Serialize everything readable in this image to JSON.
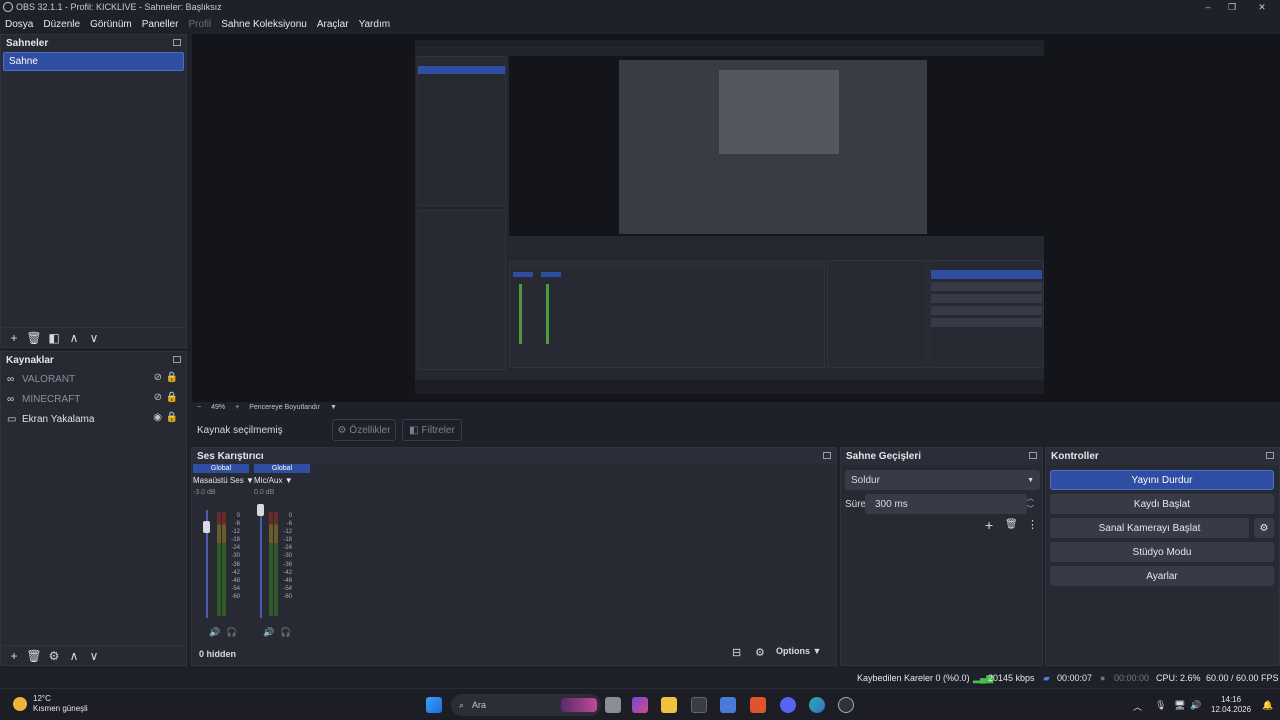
{
  "window": {
    "title": "OBS 32.1.1 - Profil: KICKLIVE - Sahneler: Başlıksız",
    "min": "–",
    "max": "❐",
    "close": "✕"
  },
  "menu": [
    "Dosya",
    "Düzenle",
    "Görünüm",
    "Paneller",
    "Profil",
    "Sahne Koleksiyonu",
    "Araçlar",
    "Yardım"
  ],
  "scenes": {
    "title": "Sahneler",
    "items": [
      "Sahne"
    ]
  },
  "sources": {
    "title": "Kaynaklar",
    "items": [
      {
        "name": "VALORANT",
        "icon": "gamepad-icon",
        "visible": false,
        "locked": true
      },
      {
        "name": "MINECRAFT",
        "icon": "gamepad-icon",
        "visible": false,
        "locked": true
      },
      {
        "name": "Ekran Yakalama",
        "icon": "monitor-icon",
        "visible": true,
        "locked": true
      }
    ]
  },
  "preview": {
    "zoom": "49%",
    "fit_label": "Pencereye Boyutlandır",
    "minus": "−",
    "plus": "+"
  },
  "context": {
    "no_source": "Kaynak seçilmemiş",
    "properties": "Özellikler",
    "filters": "Filtreler"
  },
  "mixer": {
    "title": "Ses Karıştırıcı",
    "channels": [
      {
        "scope": "Global",
        "name": "Masaüstü Ses",
        "db": "-3.0 dB"
      },
      {
        "scope": "Global",
        "name": "Mic/Aux",
        "db": "0.0 dB"
      }
    ],
    "scale": [
      "0",
      "-6",
      "-12",
      "-18",
      "-24",
      "-30",
      "-36",
      "-42",
      "-48",
      "-54",
      "-60"
    ],
    "hidden": "0 hidden",
    "options": "Options"
  },
  "transitions": {
    "title": "Sahne Geçişleri",
    "selected": "Soldur",
    "duration_label": "Süre",
    "duration": "300 ms"
  },
  "controls": {
    "title": "Kontroller",
    "stop_stream": "Yayını Durdur",
    "start_record": "Kaydı Başlat",
    "virtual_cam": "Sanal Kamerayı Başlat",
    "studio_mode": "Stüdyo Modu",
    "settings": "Ayarlar"
  },
  "status": {
    "dropped": "Kaybedilen Kareler 0 (%0.0)",
    "bitrate": "20145 kbps",
    "stream_time": "00:00:07",
    "rec_time": "00:00:00",
    "cpu": "CPU: 2.6%",
    "fps": "60.00 / 60.00 FPS"
  },
  "taskbar": {
    "temp": "12°C",
    "weather": "Kısmen güneşli",
    "search": "Ara",
    "time": "14:16",
    "date": "12.04.2026"
  },
  "colors": {
    "accent": "#2f4da1",
    "panel": "#272a33",
    "bg": "#1f212a",
    "preview_bg": "#14151a"
  }
}
